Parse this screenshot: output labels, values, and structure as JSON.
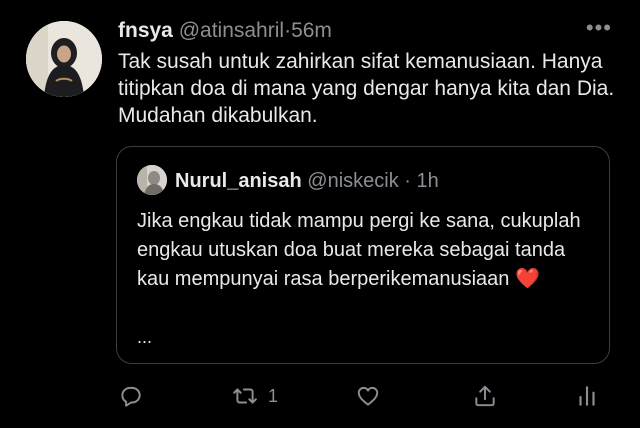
{
  "tweet": {
    "display_name": "fnsya",
    "handle": "@atinsahril",
    "separator": "·",
    "time": "56m",
    "more_label": "•••",
    "text": "Tak susah untuk zahirkan sifat kemanusiaan. Hanya titipkan doa di mana yang dengar hanya kita dan Dia. Mudahan dikabulkan."
  },
  "quote": {
    "display_name": "Nurul_anisah",
    "handle": "@niskecik",
    "separator": "·",
    "time": "1h",
    "text": "Jika engkau tidak mampu pergi ke sana, cukuplah engkau utuskan doa buat mereka sebagai tanda kau mempunyai rasa berperikemanusiaan",
    "emoji": "❤️",
    "ellipsis": "..."
  },
  "actions": {
    "retweet_count": "1"
  },
  "icons": {
    "reply": "reply-icon",
    "retweet": "retweet-icon",
    "like": "heart-icon",
    "share": "share-icon",
    "analytics": "analytics-icon"
  },
  "colors": {
    "background": "#000000",
    "text": "#e7e9ea",
    "muted": "#8b8f94",
    "border": "#3a3d41",
    "heart": "#e0263b"
  }
}
